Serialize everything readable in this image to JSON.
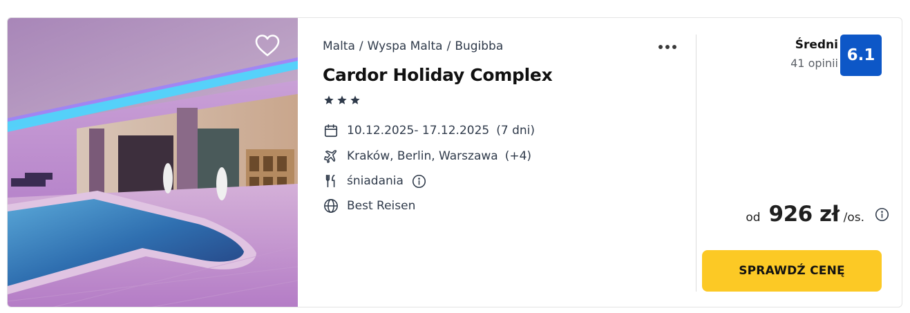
{
  "hotel": {
    "breadcrumb": [
      "Malta",
      "Wyspa Malta",
      "Bugibba"
    ],
    "breadcrumb_separator": "/",
    "name": "Cardor Holiday Complex",
    "stars": 3,
    "dates": "10.12.2025- 17.12.2025",
    "duration": "(7 dni)",
    "airports": "Kraków, Berlin, Warszawa",
    "airports_more": "(+4)",
    "board": "śniadania",
    "operator": "Best Reisen"
  },
  "rating": {
    "label": "Średni",
    "count": "41 opinii",
    "score": "6.1"
  },
  "price": {
    "from": "od",
    "amount": "926 zł",
    "per": "/os."
  },
  "cta_label": "SPRAWDŹ CENĘ",
  "icons": {
    "favorite": "heart-outline-icon",
    "more": "more-dots-icon",
    "star": "star-icon",
    "calendar": "calendar-icon",
    "plane": "plane-icon",
    "meal": "cutlery-icon",
    "info": "info-circle-icon",
    "operator": "globe-icon"
  },
  "colors": {
    "rating_badge": "#0d57c7",
    "cta": "#fcc925",
    "stars": "#2f3a4a"
  }
}
